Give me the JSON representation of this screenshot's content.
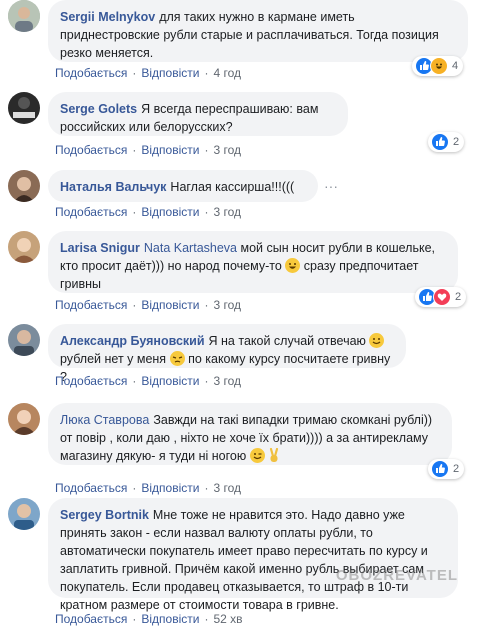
{
  "actions": {
    "like": "Подобається",
    "reply": "Відповісти",
    "dot": "·"
  },
  "comments": [
    {
      "author": "Sergii Melnykov",
      "text": "для таких нужно в кармане иметь приднестровские рубли старые и расплачиваться. Тогда позиция резко меняется.",
      "time": "4 год",
      "reactions": "4",
      "reaction_types": [
        "like-icon",
        "haha-icon"
      ]
    },
    {
      "author": "Serge Golets",
      "text": "Я всегда переспрашиваю: вам российских или белорусских?",
      "time": "3 год",
      "reactions": "2",
      "reaction_types": [
        "like-icon"
      ]
    },
    {
      "author": "Наталья Вальчук",
      "text": "Наглая кассирша!!!(((",
      "time": "3 год",
      "more": "···"
    },
    {
      "author": "Larisa Snigur",
      "mention": "Nata Kartasheva",
      "text_before_emoji": "мой сын носит рубли в кошельке, кто просит даёт))) но народ почему-то",
      "text_after_emoji": "сразу предпочитает гривны",
      "time": "3 год",
      "reactions": "2",
      "reaction_types": [
        "like-icon",
        "heart-icon"
      ]
    },
    {
      "author": "Александр Буяновский",
      "text_1": "Я на такой случай отвечаю",
      "text_2": "рублей нет у меня",
      "text_3": "по какому курсу посчитаете гривну ?",
      "time": "3 год"
    },
    {
      "author": "Люка Ставрова",
      "text": "Завжди на такі випадки тримаю скомкані рублі)) от повір , коли даю , ніхто не хоче їх брати)))) а за антирекламу магазину дякую- я туди ні ногою",
      "time": "3 год",
      "reactions": "2",
      "reaction_types": [
        "like-icon"
      ]
    },
    {
      "author": "Sergey Bortnik",
      "text": "Мне тоже не нравится это. Надо давно уже принять закон - если назвал валюту оплаты рубли, то автоматически покупатель имеет право пересчитать по курсу и заплатить гривной. Причём какой именно рубль выбирает сам покупатель. Если продавец отказывается, то штраф в 10-ти кратном размере от стоимости товара в гривне.",
      "time": "52 хв"
    }
  ],
  "watermark": "OBOZREVATEL",
  "colors": {
    "link": "#385898",
    "bubble": "#f2f3f5",
    "meta": "#606770",
    "like": "#1877f2",
    "heart": "#f33e58",
    "haha": "#f7b125"
  }
}
